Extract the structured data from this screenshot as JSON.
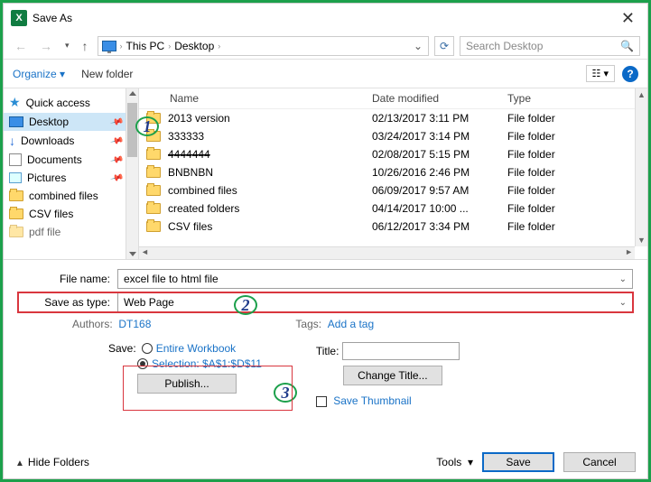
{
  "window": {
    "title": "Save As"
  },
  "nav": {
    "path": [
      "This PC",
      "Desktop"
    ],
    "search_placeholder": "Search Desktop"
  },
  "toolbar": {
    "organize": "Organize",
    "newfolder": "New folder"
  },
  "sidebar": {
    "items": [
      {
        "label": "Quick access",
        "icon": "star"
      },
      {
        "label": "Desktop",
        "icon": "desktop",
        "selected": true,
        "pinned": true
      },
      {
        "label": "Downloads",
        "icon": "download",
        "pinned": true
      },
      {
        "label": "Documents",
        "icon": "document",
        "pinned": true
      },
      {
        "label": "Pictures",
        "icon": "pictures",
        "pinned": true
      },
      {
        "label": "combined files",
        "icon": "folder"
      },
      {
        "label": "CSV files",
        "icon": "folder"
      },
      {
        "label": "pdf file",
        "icon": "folder"
      }
    ]
  },
  "filelist": {
    "headers": {
      "name": "Name",
      "date": "Date modified",
      "type": "Type"
    },
    "rows": [
      {
        "name": "2013 version",
        "date": "02/13/2017 3:11 PM",
        "type": "File folder"
      },
      {
        "name": "333333",
        "date": "03/24/2017 3:14 PM",
        "type": "File folder"
      },
      {
        "name": "4444444",
        "date": "02/08/2017 5:15 PM",
        "type": "File folder",
        "strike": true
      },
      {
        "name": "BNBNBN",
        "date": "10/26/2016 2:46 PM",
        "type": "File folder"
      },
      {
        "name": "combined files",
        "date": "06/09/2017 9:57 AM",
        "type": "File folder"
      },
      {
        "name": "created folders",
        "date": "04/14/2017 10:00 ...",
        "type": "File folder"
      },
      {
        "name": "CSV files",
        "date": "06/12/2017 3:34 PM",
        "type": "File folder"
      }
    ]
  },
  "form": {
    "filename_label": "File name:",
    "filename": "excel file to html file",
    "saveastype_label": "Save as type:",
    "saveastype": "Web Page",
    "authors_label": "Authors:",
    "authors": "DT168",
    "tags_label": "Tags:",
    "tags": "Add a tag",
    "save_label": "Save:",
    "entire_workbook": "Entire Workbook",
    "selection_label": "Selection: $A$1:$D$11",
    "publish_btn": "Publish...",
    "title_label": "Title:",
    "change_title_btn": "Change Title...",
    "save_thumb": "Save Thumbnail"
  },
  "bottom": {
    "hide_folders": "Hide Folders",
    "tools": "Tools",
    "save": "Save",
    "cancel": "Cancel"
  },
  "annotations": {
    "a1": "1",
    "a2": "2",
    "a3": "3"
  }
}
